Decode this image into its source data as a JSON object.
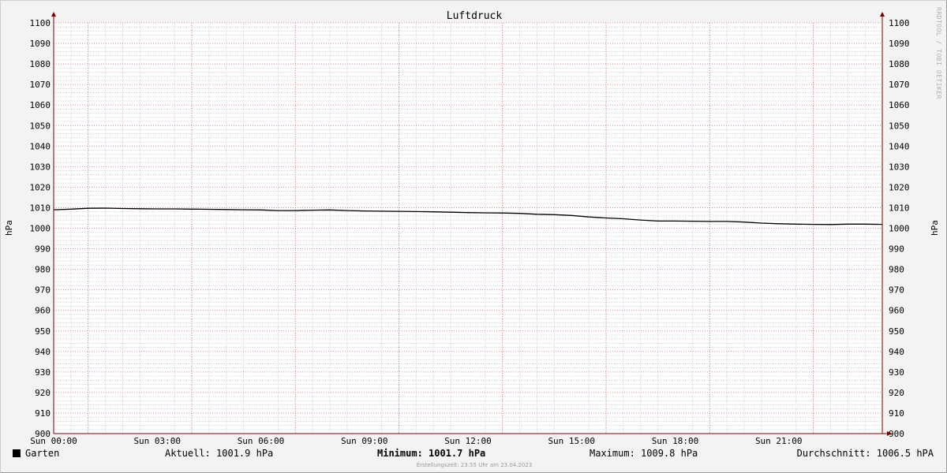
{
  "chart_data": {
    "type": "line",
    "title": "Luftdruck",
    "ylabel": "hPa",
    "ylim": [
      900,
      1100
    ],
    "yticks": [
      1100,
      1090,
      1080,
      1070,
      1060,
      1050,
      1040,
      1030,
      1020,
      1010,
      1000,
      990,
      980,
      970,
      960,
      950,
      940,
      930,
      920,
      910,
      900
    ],
    "xlim_hours": [
      0,
      24
    ],
    "xticks": [
      {
        "label": "Sun 00:00",
        "hour": 0
      },
      {
        "label": "Sun 03:00",
        "hour": 3
      },
      {
        "label": "Sun 06:00",
        "hour": 6
      },
      {
        "label": "Sun 09:00",
        "hour": 9
      },
      {
        "label": "Sun 12:00",
        "hour": 12
      },
      {
        "label": "Sun 15:00",
        "hour": 15
      },
      {
        "label": "Sun 18:00",
        "hour": 18
      },
      {
        "label": "Sun 21:00",
        "hour": 21
      }
    ],
    "grid": true,
    "series": [
      {
        "name": "Garten",
        "color": "#000000",
        "x_hours": [
          0,
          0.5,
          1,
          1.5,
          2,
          2.5,
          3,
          3.5,
          4,
          4.5,
          5,
          5.5,
          6,
          6.5,
          7,
          7.5,
          8,
          8.5,
          9,
          9.5,
          10,
          10.5,
          11,
          11.5,
          12,
          12.5,
          13,
          13.5,
          14,
          14.5,
          15,
          15.5,
          16,
          16.5,
          17,
          17.5,
          18,
          18.5,
          19,
          19.5,
          20,
          20.5,
          21,
          21.5,
          22,
          22.5,
          23,
          23.5,
          24
        ],
        "values": [
          1009.0,
          1009.3,
          1009.7,
          1009.8,
          1009.6,
          1009.5,
          1009.4,
          1009.4,
          1009.3,
          1009.2,
          1009.1,
          1009.0,
          1008.9,
          1008.6,
          1008.6,
          1008.8,
          1008.9,
          1008.6,
          1008.4,
          1008.3,
          1008.2,
          1008.1,
          1008.0,
          1007.8,
          1007.6,
          1007.5,
          1007.4,
          1007.2,
          1006.8,
          1006.6,
          1006.2,
          1005.5,
          1005.0,
          1004.6,
          1004.0,
          1003.5,
          1003.5,
          1003.4,
          1003.3,
          1003.3,
          1003.0,
          1002.5,
          1002.2,
          1002.0,
          1001.9,
          1001.8,
          1002.0,
          1002.0,
          1001.9
        ]
      }
    ],
    "watermark": "RRDTOOL / TOBI OETIKER"
  },
  "legend": {
    "series_name": "Garten",
    "aktuell": "Aktuell: 1001.9 hPa",
    "minimum": "Minimum: 1001.7 hPa",
    "maximum": "Maximum: 1009.8 hPa",
    "durchschnitt": "Durchschnitt: 1006.5 hPA"
  },
  "footer": "Erstellungszeit: 23:55 Uhr am 23.04.2023",
  "colors": {
    "background": "#f3f3f3",
    "plot_background": "#ffffff",
    "minor_grid": "#d8d8d8",
    "major_grid": "#e07070",
    "axis": "#7a0000",
    "line": "#000000"
  }
}
